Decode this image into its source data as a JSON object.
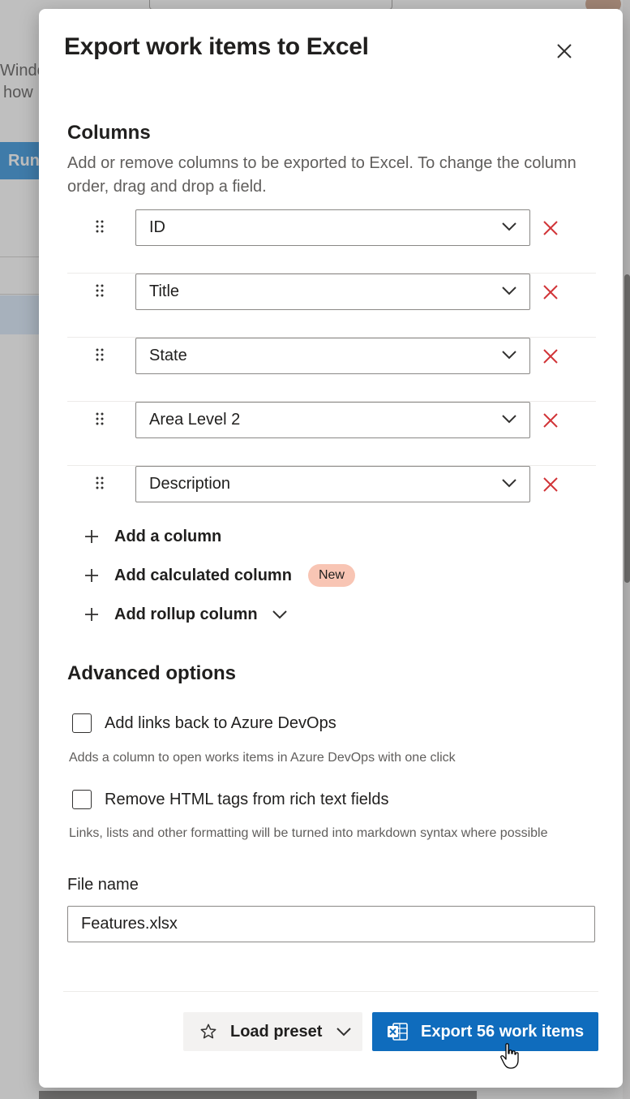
{
  "background": {
    "text_line_1": "Window",
    "text_line_2": "how",
    "run_button": "Run"
  },
  "dialog": {
    "title": "Export work items to Excel",
    "close_icon": "close-icon"
  },
  "columns_section": {
    "title": "Columns",
    "description": "Add or remove columns to be exported to Excel. To change the column order, drag and drop a field.",
    "columns": [
      {
        "label": "ID"
      },
      {
        "label": "Title"
      },
      {
        "label": "State"
      },
      {
        "label": "Area Level 2"
      },
      {
        "label": "Description"
      }
    ],
    "add_column_label": "Add a column",
    "add_calculated_label": "Add calculated column",
    "new_badge": "New",
    "add_rollup_label": "Add rollup column"
  },
  "advanced_section": {
    "title": "Advanced options",
    "links_back_label": "Add links back to Azure DevOps",
    "links_back_hint": "Adds a column to open works items in Azure DevOps with one click",
    "links_back_checked": false,
    "remove_html_label": "Remove HTML tags from rich text fields",
    "remove_html_hint": "Links, lists and other formatting will be turned into markdown syntax where possible",
    "remove_html_checked": false
  },
  "file": {
    "label": "File name",
    "value": "Features.xlsx"
  },
  "footer": {
    "load_preset_label": "Load preset",
    "export_label": "Export 56 work items"
  },
  "colors": {
    "primary": "#0f6cbd",
    "remove_red": "#d13438",
    "badge_bg": "#f8c5b4"
  }
}
